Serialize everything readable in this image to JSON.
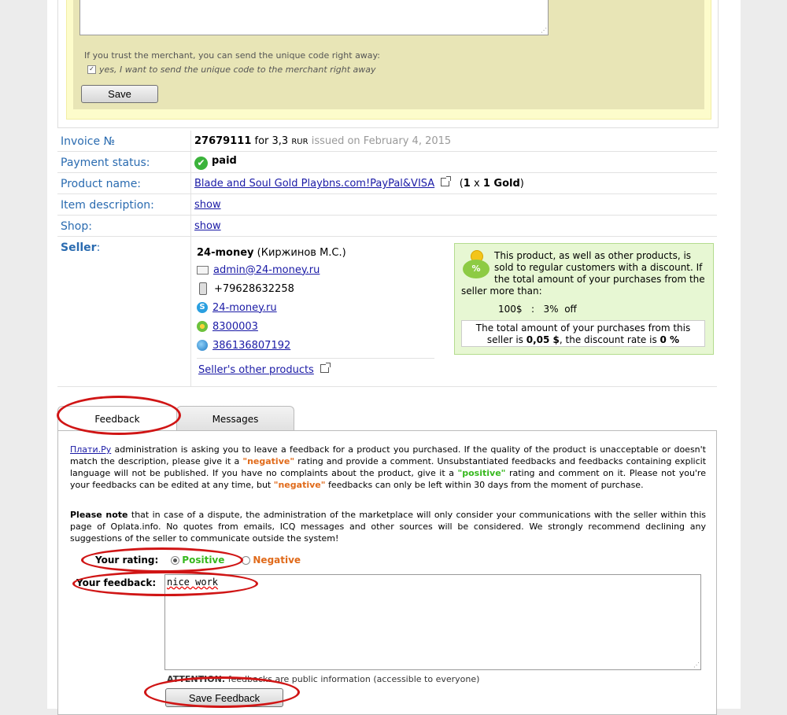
{
  "unique_code": {
    "trust_text": "If you trust the merchant, you can send the unique code right away:",
    "checkbox_label": "yes, I want to send the unique code to the merchant right away",
    "save_label": "Save"
  },
  "invoice": {
    "label": "Invoice №",
    "number": "27679111",
    "for_text": "for 3,3",
    "currency": "RUR",
    "issued": "issued on February 4, 2015"
  },
  "payment": {
    "label": "Payment status:",
    "status": "paid"
  },
  "product": {
    "label": "Product name:",
    "name": "Blade and Soul Gold Playbns.com!PayPal&VISA",
    "qty_open": "(",
    "qty_count": "1",
    "qty_x": "x",
    "qty_amount": "1 Gold",
    "qty_close": ")"
  },
  "item_description": {
    "label": "Item description:",
    "link": "show"
  },
  "shop": {
    "label": "Shop:",
    "link": "show"
  },
  "seller": {
    "label": "Seller",
    "label_colon": ":",
    "name": "24-money",
    "owner": "(Киржинов М.С.)",
    "email": "admin@24-money.ru",
    "phone": "+79628632258",
    "skype": "24-money.ru",
    "icq": "8300003",
    "wm": "386136807192",
    "other_products": "Seller's other products"
  },
  "discount": {
    "text": "This product, as well as other products, is sold to regular customers with a discount. If the total amount of your purchases from the seller more than:",
    "threshold": "100$",
    "sep": ":",
    "rate": "3%",
    "off": "off",
    "summary_prefix": "The total amount of your purchases from this seller is",
    "summary_amount": "0,05 $",
    "summary_mid": ", the discount rate is",
    "summary_rate": "0 %"
  },
  "tabs": {
    "feedback": "Feedback",
    "messages": "Messages"
  },
  "feedback": {
    "link": "Плати.Ру",
    "p1_a": "administration is asking you to leave a feedback for a product you purchased. If the quality of the product is unacceptable or doesn't match the description, please give it a",
    "p1_neg": "\"negative\"",
    "p1_b": "rating and provide a comment. Unsubstantiated feedbacks and feedbacks containing explicit language will not be published. If you have no complaints about the product, give it a",
    "p1_pos": "\"positive\"",
    "p1_c": "rating and comment on it. Please not you're your feedbacks can be edited at any time, but",
    "p1_neg2": "\"negative\"",
    "p1_d": "feedbacks can only be left within 30 days from the moment of purchase.",
    "p2_bold": "Please note",
    "p2": "that in case of a dispute, the administration of the marketplace will only consider your communications with the seller within this page of Oplata.info. No quotes from emails, ICQ messages and other sources will be considered. We strongly recommend declining any suggestions of the seller to communicate outside the system!",
    "rating_label": "Your rating:",
    "positive": "Positive",
    "negative": "Negative",
    "feedback_label": "Your feedback:",
    "feedback_value": "nice work",
    "attention_bold": "ATTENTION:",
    "attention": "feedbacks are public information (accessible to everyone)",
    "save_label": "Save Feedback"
  },
  "colors": {
    "link": "#1a1aa6",
    "label_blue": "#2a6bb0",
    "positive": "#37b81e",
    "negative": "#e06a1a",
    "annotation": "#d01515"
  }
}
